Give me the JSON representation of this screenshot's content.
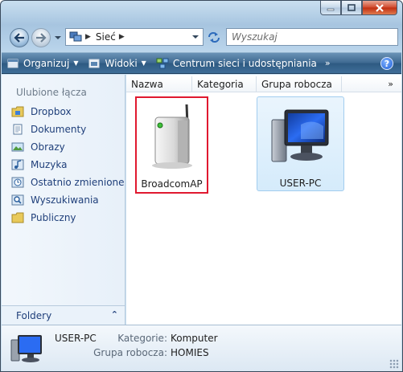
{
  "window": {
    "address": {
      "crumb": "Sieć"
    },
    "search": {
      "placeholder": "Wyszukaj"
    }
  },
  "toolbar": {
    "organize": "Organizuj",
    "views": "Widoki",
    "network_center": "Centrum sieci i udostępniania",
    "more": "»",
    "help": "?"
  },
  "nav": {
    "title": "Ulubione łącza",
    "items": [
      {
        "label": "Dropbox",
        "icon": "dropbox-folder-icon"
      },
      {
        "label": "Dokumenty",
        "icon": "documents-icon"
      },
      {
        "label": "Obrazy",
        "icon": "pictures-icon"
      },
      {
        "label": "Muzyka",
        "icon": "music-icon"
      },
      {
        "label": "Ostatnio zmienione",
        "icon": "recent-icon"
      },
      {
        "label": "Wyszukiwania",
        "icon": "searches-icon"
      },
      {
        "label": "Publiczny",
        "icon": "public-folder-icon"
      }
    ],
    "folders_label": "Foldery"
  },
  "columns": [
    "Nazwa",
    "Kategoria",
    "Grupa robocza"
  ],
  "columns_more": "»",
  "items": [
    {
      "name": "BroadcomAP",
      "icon": "router-icon",
      "highlighted": true
    },
    {
      "name": "USER-PC",
      "icon": "computer-icon",
      "selected": true
    }
  ],
  "details": {
    "name": "USER-PC",
    "category_label": "Kategorie:",
    "category_value": "Komputer",
    "workgroup_label": "Grupa robocza:",
    "workgroup_value": "HOMIES"
  },
  "colors": {
    "command_bar": "#3f6a91",
    "highlight_border": "#e0192f",
    "selection": "#d5ebfb"
  }
}
